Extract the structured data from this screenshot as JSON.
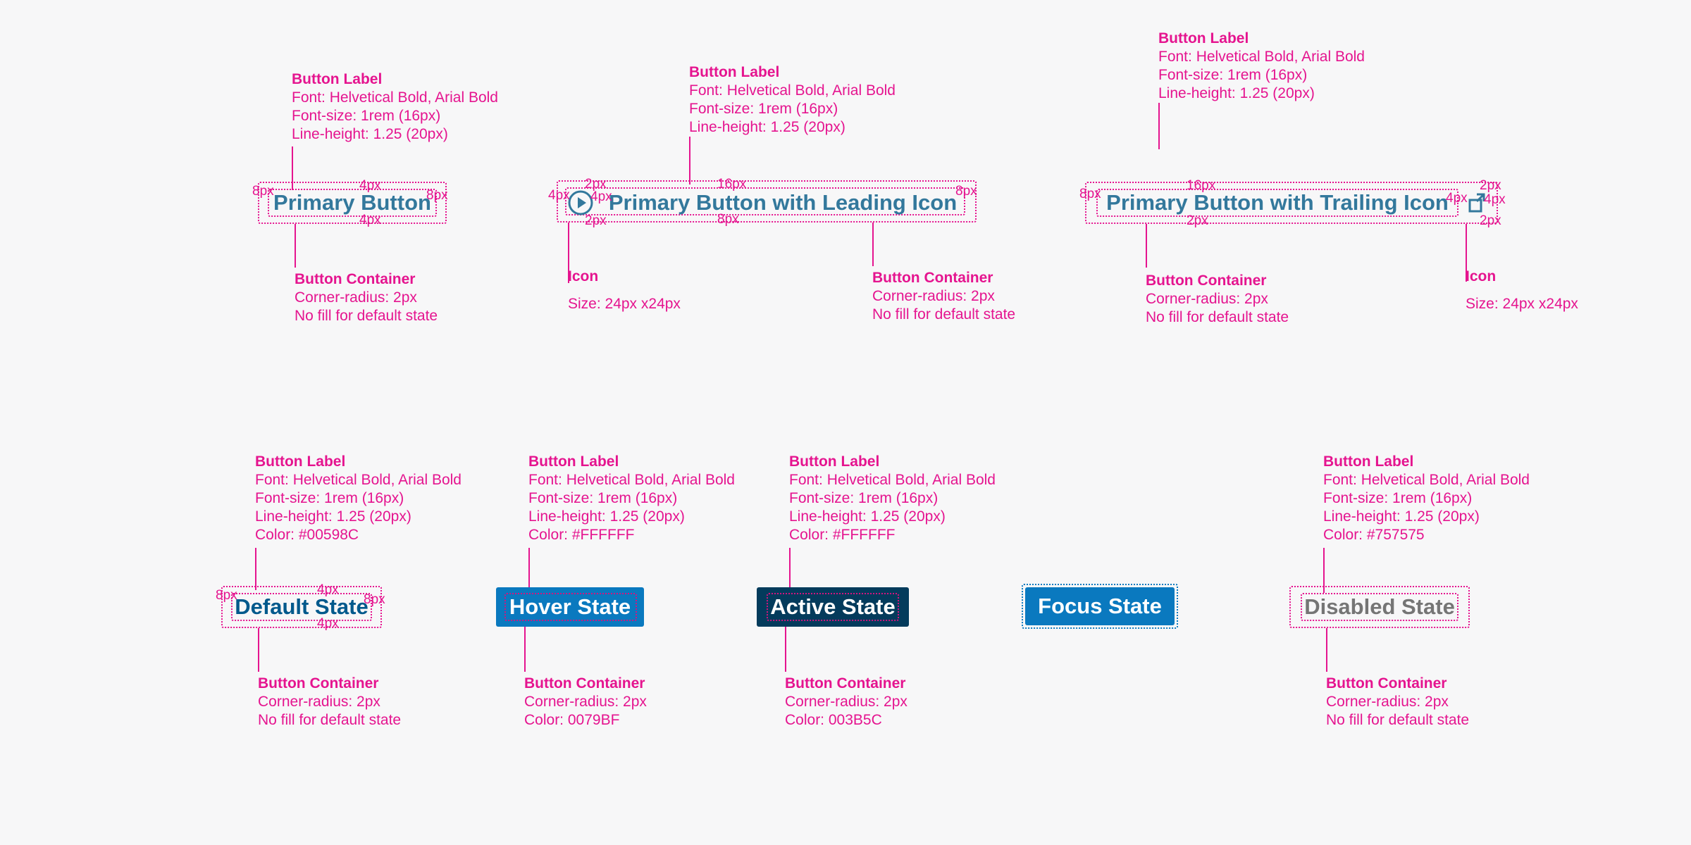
{
  "colors": {
    "annotation": "#e5148f",
    "background": "#f7f7f8",
    "label_default": "#33789c",
    "default_state_text": "#00598C",
    "hover_fill": "#0079BF",
    "active_fill": "#003B5C",
    "disabled_text": "#757575"
  },
  "dims": {
    "px8": "8px",
    "px4": "4px",
    "px2": "2px",
    "px16": "16px"
  },
  "row1": {
    "primary": {
      "label": "Primary Button",
      "label_anno": [
        "Button Label",
        "Font: Helvetical Bold, Arial Bold",
        "Font-size: 1rem (16px)",
        "Line-height: 1.25 (20px)"
      ],
      "container_anno": [
        "Button Container",
        "Corner-radius: 2px",
        "No fill for default state"
      ]
    },
    "leading": {
      "label": "Primary Button with Leading Icon",
      "icon": "play-circle-icon",
      "label_anno": [
        "Button Label",
        "Font: Helvetical Bold, Arial Bold",
        "Font-size: 1rem (16px)",
        "Line-height: 1.25 (20px)"
      ],
      "container_anno": [
        "Button Container",
        "Corner-radius: 2px",
        "No fill for default state"
      ],
      "icon_anno": [
        "Icon",
        "Size: 24px x24px"
      ]
    },
    "trailing": {
      "label": "Primary Button with Trailing Icon",
      "icon": "external-link-icon",
      "label_anno": [
        "Button Label",
        "Font: Helvetical Bold, Arial Bold",
        "Font-size: 1rem (16px)",
        "Line-height: 1.25 (20px)"
      ],
      "container_anno": [
        "Button Container",
        "Corner-radius: 2px",
        "No fill for default state"
      ],
      "icon_anno": [
        "Icon",
        "Size: 24px x24px"
      ]
    }
  },
  "row2": {
    "default": {
      "label": "Default State",
      "label_anno": [
        "Button Label",
        "Font: Helvetical Bold, Arial Bold",
        "Font-size: 1rem (16px)",
        "Line-height: 1.25 (20px)",
        "Color: #00598C"
      ],
      "container_anno": [
        "Button Container",
        "Corner-radius: 2px",
        "No fill for default state"
      ]
    },
    "hover": {
      "label": "Hover State",
      "label_anno": [
        "Button Label",
        "Font: Helvetical Bold, Arial Bold",
        "Font-size: 1rem (16px)",
        "Line-height: 1.25 (20px)",
        "Color: #FFFFFF"
      ],
      "container_anno": [
        "Button Container",
        "Corner-radius: 2px",
        "Color: 0079BF"
      ]
    },
    "active": {
      "label": "Active State",
      "label_anno": [
        "Button Label",
        "Font: Helvetical Bold, Arial Bold",
        "Font-size: 1rem (16px)",
        "Line-height: 1.25 (20px)",
        "Color: #FFFFFF"
      ],
      "container_anno": [
        "Button Container",
        "Corner-radius: 2px",
        "Color: 003B5C"
      ]
    },
    "focus": {
      "label": "Focus State"
    },
    "disabled": {
      "label": "Disabled State",
      "label_anno": [
        "Button Label",
        "Font: Helvetical Bold, Arial Bold",
        "Font-size: 1rem (16px)",
        "Line-height: 1.25 (20px)",
        "Color: #757575"
      ],
      "container_anno": [
        "Button Container",
        "Corner-radius: 2px",
        "No fill for default state"
      ]
    }
  }
}
